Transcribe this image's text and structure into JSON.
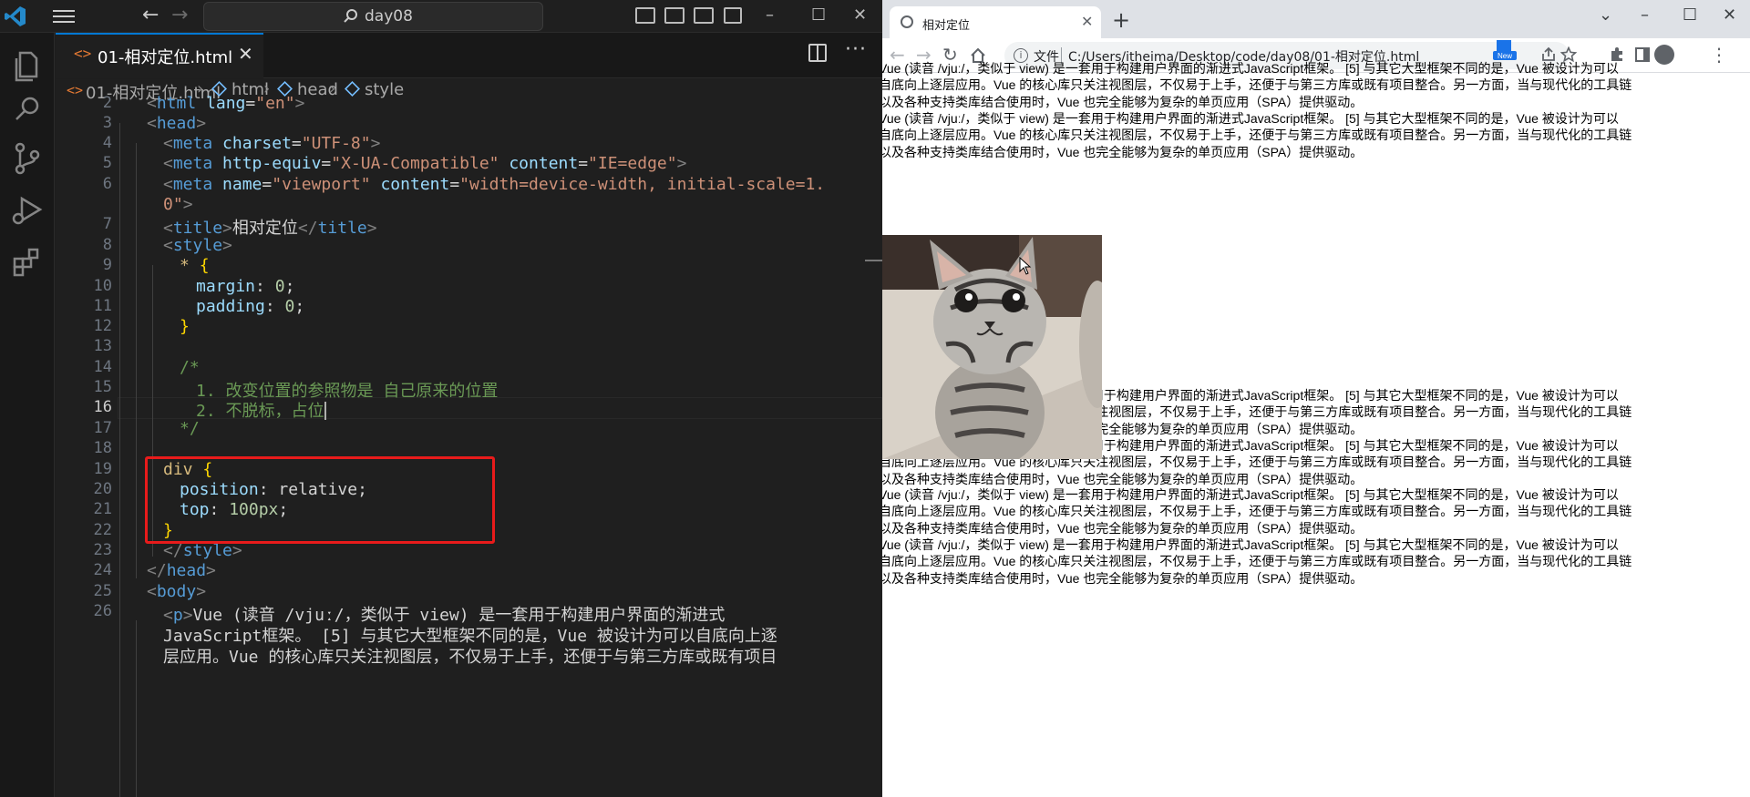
{
  "vscode": {
    "search_text": "day08",
    "tab_label": "01-相对定位.html",
    "breadcrumb": [
      "01-相对定位.html",
      "html",
      "head",
      "style"
    ],
    "lines": [
      {
        "n": "2"
      },
      {
        "n": "3"
      },
      {
        "n": "4"
      },
      {
        "n": "5"
      },
      {
        "n": "6"
      },
      {
        "n": ""
      },
      {
        "n": "7"
      },
      {
        "n": "8"
      },
      {
        "n": "9"
      },
      {
        "n": "10"
      },
      {
        "n": "11"
      },
      {
        "n": "12"
      },
      {
        "n": "13"
      },
      {
        "n": "14"
      },
      {
        "n": "15"
      },
      {
        "n": "16"
      },
      {
        "n": "17"
      },
      {
        "n": "18"
      },
      {
        "n": "19"
      },
      {
        "n": "20"
      },
      {
        "n": "21"
      },
      {
        "n": "22"
      },
      {
        "n": "23"
      },
      {
        "n": "24"
      },
      {
        "n": "25"
      },
      {
        "n": "26"
      },
      {
        "n": ""
      },
      {
        "n": ""
      }
    ],
    "code": {
      "l2_tag": "html",
      "l2_attr": "lang",
      "l2_val": "\"en\"",
      "l3_tag": "head",
      "l4_tag": "meta",
      "l4_attr": "charset",
      "l4_val": "\"UTF-8\"",
      "l5_tag": "meta",
      "l5_attr1": "http-equiv",
      "l5_val1": "\"X-UA-Compatible\"",
      "l5_attr2": "content",
      "l5_val2": "\"IE=edge\"",
      "l6_tag": "meta",
      "l6_attr1": "name",
      "l6_val1": "\"viewport\"",
      "l6_attr2": "content",
      "l6_val2": "\"width=device-width, initial-scale=1.",
      "l6b_val": "0\"",
      "l7_tag": "title",
      "l7_text": "相对定位",
      "l7_close": "title",
      "l8_tag": "style",
      "l9_sel": "*",
      "l9_brace": "{",
      "l10_prop": "margin",
      "l10_val": "0",
      "l11_prop": "padding",
      "l11_val": "0",
      "l12_brace": "}",
      "l14_cmt": "/*",
      "l15_cmt": "1. 改变位置的参照物是 自己原来的位置",
      "l16_cmt": "2. 不脱标，占位",
      "l17_cmt": "*/",
      "l19_sel": "div",
      "l19_brace": "{",
      "l20_prop": "position",
      "l20_val": "relative",
      "l21_prop": "top",
      "l21_val": "100px",
      "l22_brace": "}",
      "l23_tag": "style",
      "l24_tag": "head",
      "l25_tag": "body",
      "l26_tag": "p",
      "l26_text": "Vue (读音 /vjuː/，类似于 view) 是一套用于构建用户界面的渐进式",
      "l26b_text": "JavaScript框架。 [5] 与其它大型框架不同的是，Vue 被设计为可以自底向上逐",
      "l26c_text": "层应用。Vue 的核心库只关注视图层，不仅易于上手，还便于与第三方库或既有项目"
    }
  },
  "chrome": {
    "tab_title": "相对定位",
    "file_label": "文件",
    "url": "C:/Users/itheima/Desktop/code/day08/01-相对定位.html",
    "new_badge": "New",
    "paragraph_lines": [
      "Vue (读音 /vjuː/，类似于 view) 是一套用于构建用户界面的渐进式JavaScript框架。 [5] 与其它大型框架不同的是，Vue 被设计为可以",
      "自底向上逐层应用。Vue 的核心库只关注视图层，不仅易于上手，还便于与第三方库或既有项目整合。另一方面，当与现代化的工具链",
      "以及各种支持类库结合使用时，Vue 也完全能够为复杂的单页应用（SPA）提供驱动。"
    ]
  }
}
